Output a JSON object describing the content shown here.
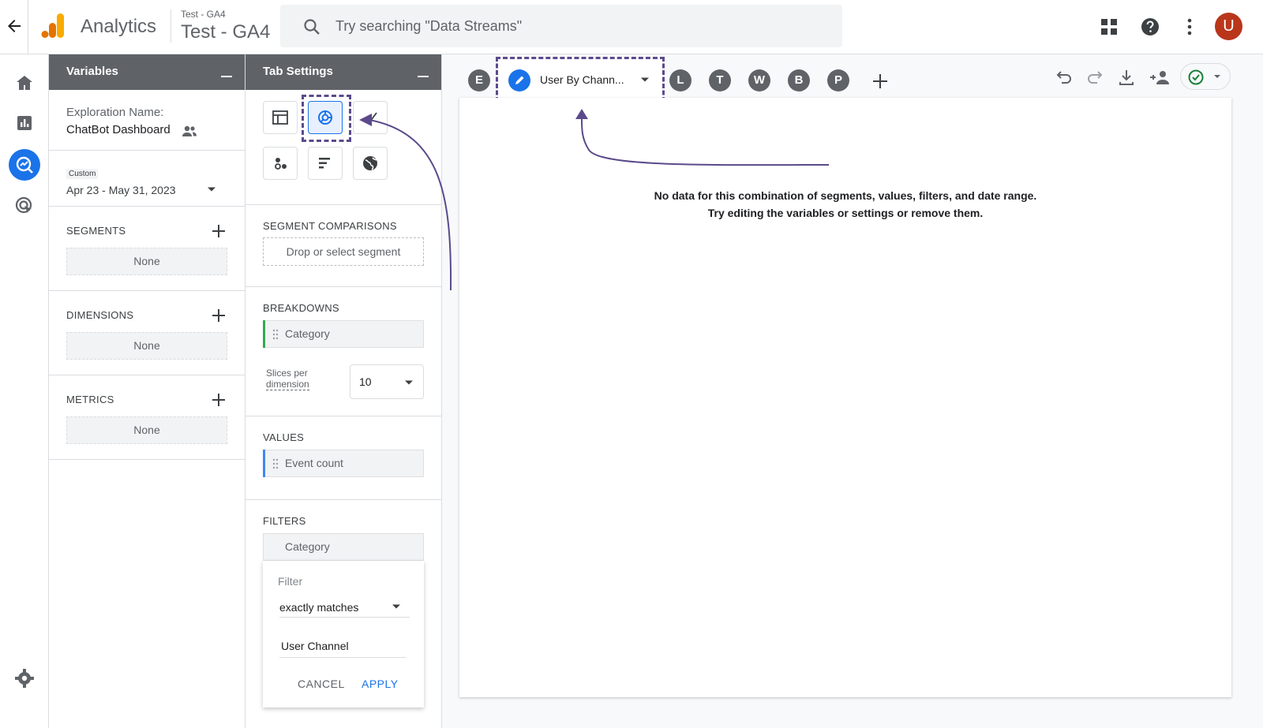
{
  "header": {
    "app_name": "Analytics",
    "account_small": "Test - GA4",
    "account_big": "Test - GA4",
    "search_placeholder": "Try searching \"Data Streams\"",
    "avatar_letter": "U"
  },
  "variables": {
    "title": "Variables",
    "exploration_label": "Exploration Name:",
    "exploration_name": "ChatBot Dashboard",
    "date_badge": "Custom",
    "date_range": "Apr 23 - May 31, 2023",
    "segments_label": "SEGMENTS",
    "segments_value": "None",
    "dimensions_label": "DIMENSIONS",
    "dimensions_value": "None",
    "metrics_label": "METRICS",
    "metrics_value": "None"
  },
  "tab_settings": {
    "title": "Tab Settings",
    "segment_comparisons_label": "SEGMENT COMPARISONS",
    "segment_drop": "Drop or select segment",
    "breakdowns_label": "BREAKDOWNS",
    "breakdown_item": "Category",
    "slices_label_1": "Slices per",
    "slices_label_2": "dimension",
    "slices_value": "10",
    "values_label": "VALUES",
    "value_item": "Event count",
    "filters_label": "FILTERS",
    "filter_item": "Category",
    "filter_sub_label": "Filter",
    "filter_match": "exactly matches",
    "filter_value": "User Channel",
    "cancel": "CANCEL",
    "apply": "APPLY"
  },
  "canvas": {
    "tabs": [
      "E",
      "L",
      "T",
      "W",
      "B",
      "P"
    ],
    "active_tab": "User By Chann...",
    "message_line1": "No data for this combination of segments, values, filters, and date range.",
    "message_line2": "Try editing the variables or settings or remove them."
  },
  "colors": {
    "accent": "#1a73e8",
    "annotation": "#5b4a8b",
    "header_bg": "#5f6368",
    "avatar": "#b9361b"
  }
}
